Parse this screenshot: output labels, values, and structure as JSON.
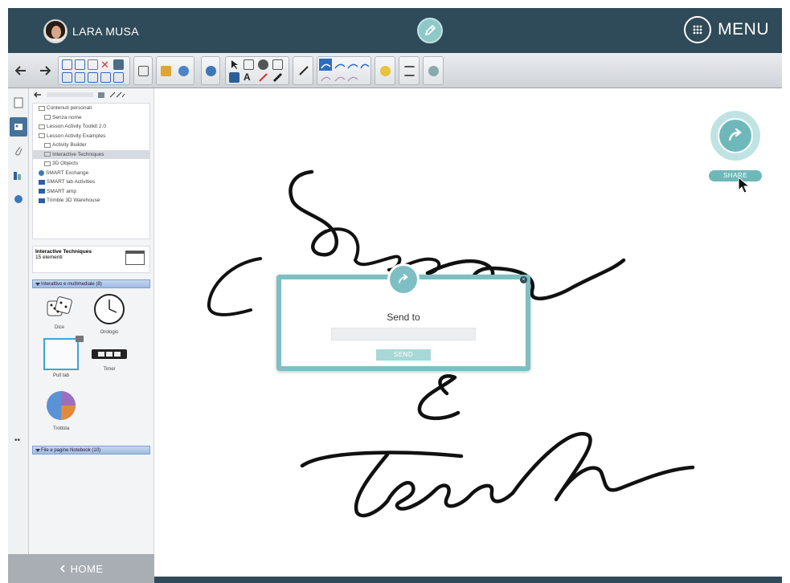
{
  "header": {
    "user_name": "LARA MUSA",
    "menu_label": "MENU"
  },
  "sidebar": {
    "tree": [
      {
        "label": "Contenuti personali",
        "indent": 1,
        "icon": "folder"
      },
      {
        "label": "Senza nome",
        "indent": 2,
        "icon": "folder"
      },
      {
        "label": "Lesson Activity Toolkit 2.0",
        "indent": 1,
        "icon": "folder"
      },
      {
        "label": "Lesson Activity Examples",
        "indent": 1,
        "icon": "folder"
      },
      {
        "label": "Activity Builder",
        "indent": 2,
        "icon": "folder"
      },
      {
        "label": "Interactive Techniques",
        "indent": 2,
        "icon": "folder",
        "selected": true
      },
      {
        "label": "3D Objects",
        "indent": 2,
        "icon": "folder"
      },
      {
        "label": "SMART Exchange",
        "indent": 1,
        "icon": "globe"
      },
      {
        "label": "SMART lab Activities",
        "indent": 1,
        "icon": "blue"
      },
      {
        "label": "SMART amp",
        "indent": 1,
        "icon": "blue"
      },
      {
        "label": "Trimble 3D Warehouse",
        "indent": 1,
        "icon": "blue"
      }
    ],
    "category_title": "Interactive Techniques",
    "category_count": "15 elementi",
    "section1": "Interattivo e multimediale (8)",
    "thumbs": [
      {
        "label": "Dice"
      },
      {
        "label": "Orologio"
      },
      {
        "label": "Pull tab"
      },
      {
        "label": "Timer"
      },
      {
        "label": "Trottola"
      }
    ],
    "section2": "File e pagine Notebook (10)",
    "home_label": "HOME"
  },
  "share": {
    "label": "SHARE"
  },
  "dialog": {
    "title": "Send to",
    "input_placeholder": "",
    "send_label": "SEND"
  },
  "colors": {
    "header": "#2f4a58",
    "accent": "#7dbfc2",
    "ink": "#111111"
  }
}
